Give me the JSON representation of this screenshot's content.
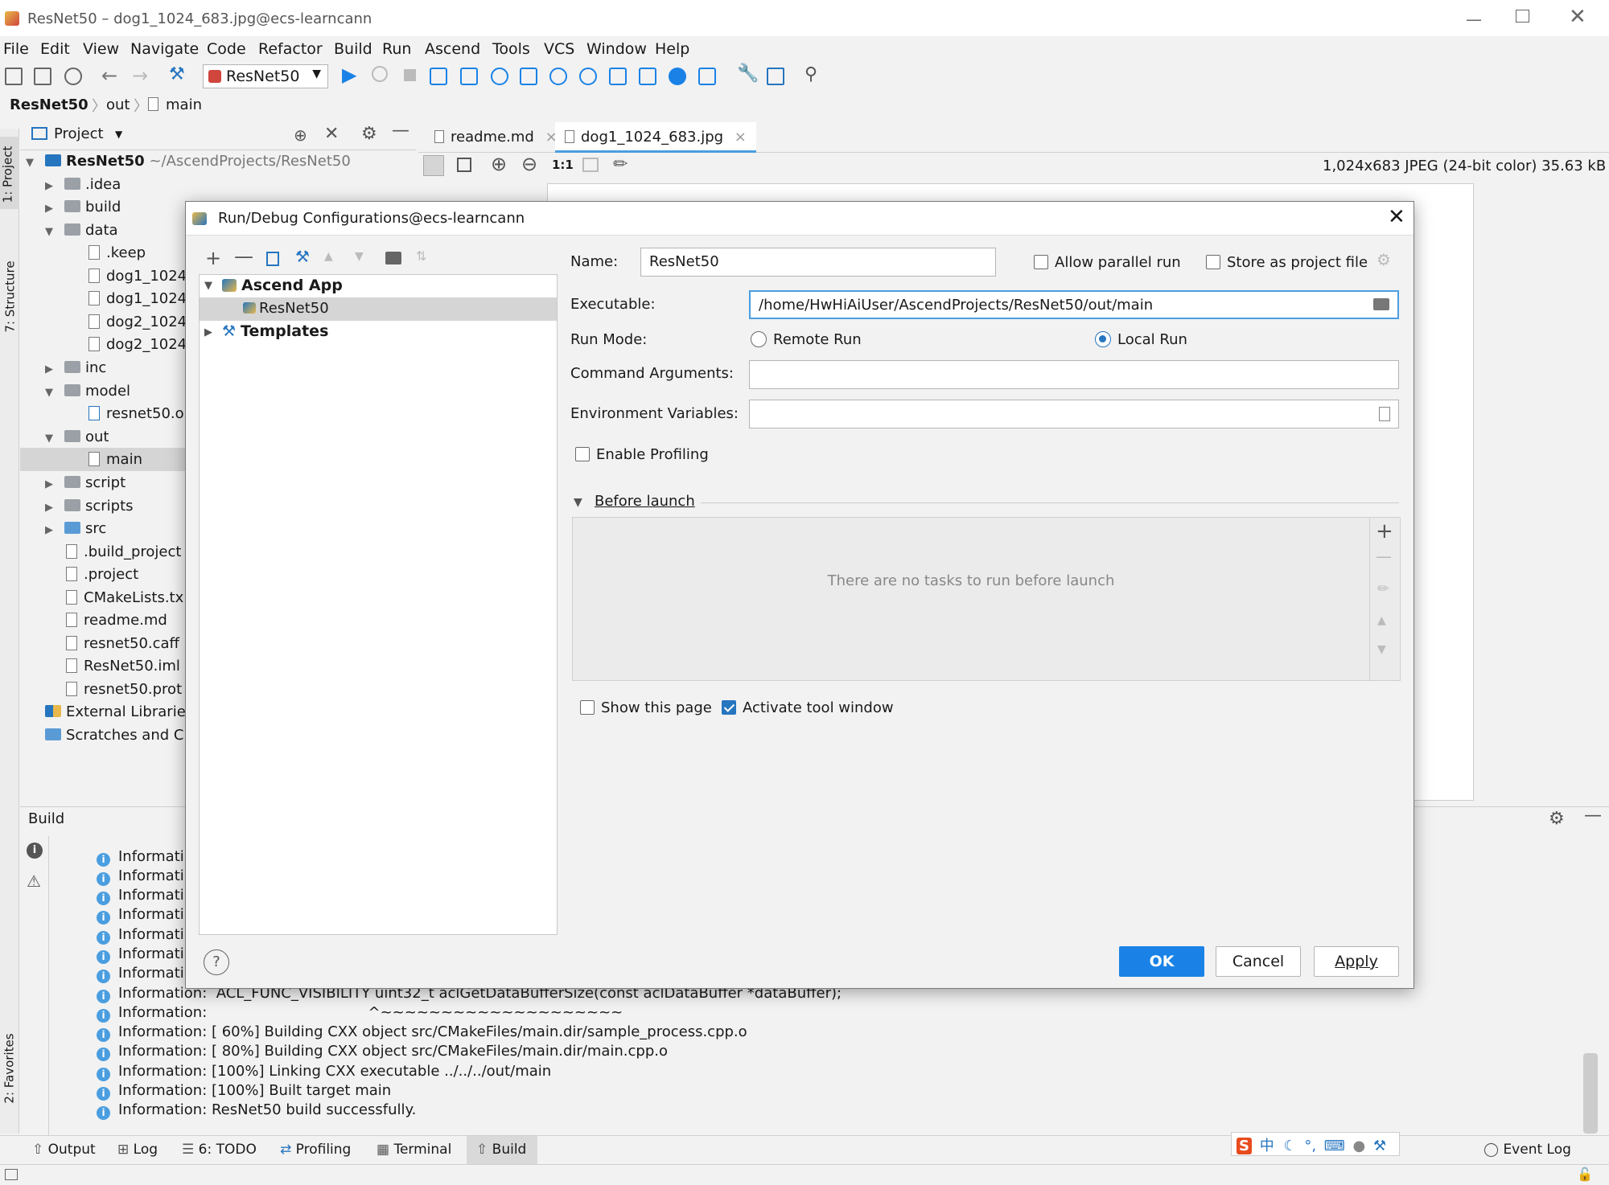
{
  "window": {
    "title": "ResNet50 – dog1_1024_683.jpg@ecs-learncann"
  },
  "menu": [
    "File",
    "Edit",
    "View",
    "Navigate",
    "Code",
    "Refactor",
    "Build",
    "Run",
    "Ascend",
    "Tools",
    "VCS",
    "Window",
    "Help"
  ],
  "toolbar": {
    "run_config": "ResNet50"
  },
  "breadcrumb": [
    "ResNet50",
    "out",
    "main"
  ],
  "side_tabs": {
    "project": "1: Project",
    "structure": "7: Structure",
    "favorites": "2: Favorites"
  },
  "project_panel": {
    "title": "Project",
    "root_name": "ResNet50",
    "root_path": "~/AscendProjects/ResNet50",
    "items": [
      {
        "label": ".idea"
      },
      {
        "label": "build"
      },
      {
        "label": "data"
      },
      {
        "label": ".keep"
      },
      {
        "label": "dog1_1024"
      },
      {
        "label": "dog1_1024"
      },
      {
        "label": "dog2_1024"
      },
      {
        "label": "dog2_1024"
      },
      {
        "label": "inc"
      },
      {
        "label": "model"
      },
      {
        "label": "resnet50.o"
      },
      {
        "label": "out"
      },
      {
        "label": "main"
      },
      {
        "label": "script"
      },
      {
        "label": "scripts"
      },
      {
        "label": "src"
      },
      {
        "label": ".build_project"
      },
      {
        "label": ".project"
      },
      {
        "label": "CMakeLists.tx"
      },
      {
        "label": "readme.md"
      },
      {
        "label": "resnet50.caff"
      },
      {
        "label": "ResNet50.iml"
      },
      {
        "label": "resnet50.prot"
      },
      {
        "label": "External Libraries"
      },
      {
        "label": "Scratches and C"
      }
    ]
  },
  "editor": {
    "tabs": [
      {
        "label": "readme.md"
      },
      {
        "label": "dog1_1024_683.jpg"
      }
    ],
    "zoom_actual": "1:1",
    "image_info": "1,024x683 JPEG (24-bit color) 35.63 kB"
  },
  "dialog": {
    "title": "Run/Debug Configurations@ecs-learncann",
    "tree": {
      "group": "Ascend App",
      "child": "ResNet50",
      "templates": "Templates"
    },
    "name_label": "Name:",
    "name_value": "ResNet50",
    "allow_parallel": "Allow parallel run",
    "store_project": "Store as project file",
    "executable_label": "Executable:",
    "executable_value": "/home/HwHiAiUser/AscendProjects/ResNet50/out/main",
    "run_mode_label": "Run Mode:",
    "remote_run": "Remote Run",
    "local_run": "Local Run",
    "cmd_args_label": "Command Arguments:",
    "env_vars_label": "Environment Variables:",
    "enable_profiling": "Enable Profiling",
    "before_launch": "Before launch",
    "no_tasks": "There are no tasks to run before launch",
    "show_page": "Show this page",
    "activate_window": "Activate tool window",
    "ok": "OK",
    "cancel": "Cancel",
    "apply": "Apply",
    "help": "?"
  },
  "build_panel": {
    "title": "Build",
    "lines": [
      "Informati",
      "Informati",
      "Informati",
      "Informati",
      "Informati",
      "Informati",
      "Informati",
      "Information:  ACL_FUNC_VISIBILITY uint32_t aclGetDataBufferSize(const aclDataBuffer *dataBuffer);",
      "Information:                                   ^~~~~~~~~~~~~~~~~~~~~",
      "Information: [ 60%] Building CXX object src/CMakeFiles/main.dir/sample_process.cpp.o",
      "Information: [ 80%] Building CXX object src/CMakeFiles/main.dir/main.cpp.o",
      "Information: [100%] Linking CXX executable ../../../out/main",
      "Information: [100%] Built target main",
      "Information: ResNet50 build successfully."
    ]
  },
  "bottom_tabs": [
    {
      "label": "Output"
    },
    {
      "label": "Log"
    },
    {
      "label": "6: TODO"
    },
    {
      "label": "Profiling"
    },
    {
      "label": "Terminal"
    },
    {
      "label": "Build"
    }
  ],
  "event_log": "Event Log",
  "ime": "中"
}
